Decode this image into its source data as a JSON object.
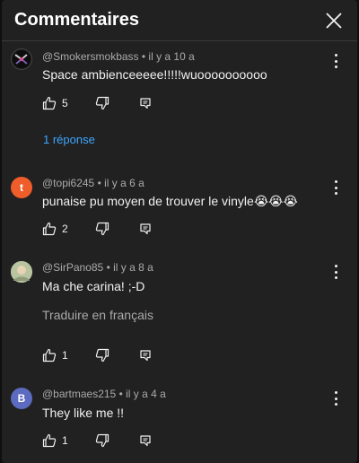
{
  "header": {
    "title": "Commentaires"
  },
  "comments": [
    {
      "author": "@Smokersmokbass",
      "time": "il y a 10 a",
      "text": "Space ambienceeeee!!!!!wuoooooooooo",
      "likes": "5",
      "replies_label": "1 réponse"
    },
    {
      "author": "@topi6245",
      "time": "il y a 6 a",
      "avatar_letter": "t",
      "avatar_color": "#ef5d2a",
      "text": "punaise pu moyen de trouver le vinyle",
      "emoji": "😭😭😭",
      "likes": "2"
    },
    {
      "author": "@SirPano85",
      "time": "il y a 8 a",
      "text": "Ma che carina!  ;-D",
      "translate_label": "Traduire en français",
      "likes": "1"
    },
    {
      "author": "@bartmaes215",
      "time": "il y a 4 a",
      "avatar_letter": "B",
      "avatar_color": "#5c6bc0",
      "text": "They like me !!",
      "likes": "1"
    }
  ],
  "icons": {
    "close": "close-icon",
    "like": "thumb-up-icon",
    "dislike": "thumb-down-icon",
    "reply": "reply-icon",
    "more": "more-vertical-icon"
  }
}
